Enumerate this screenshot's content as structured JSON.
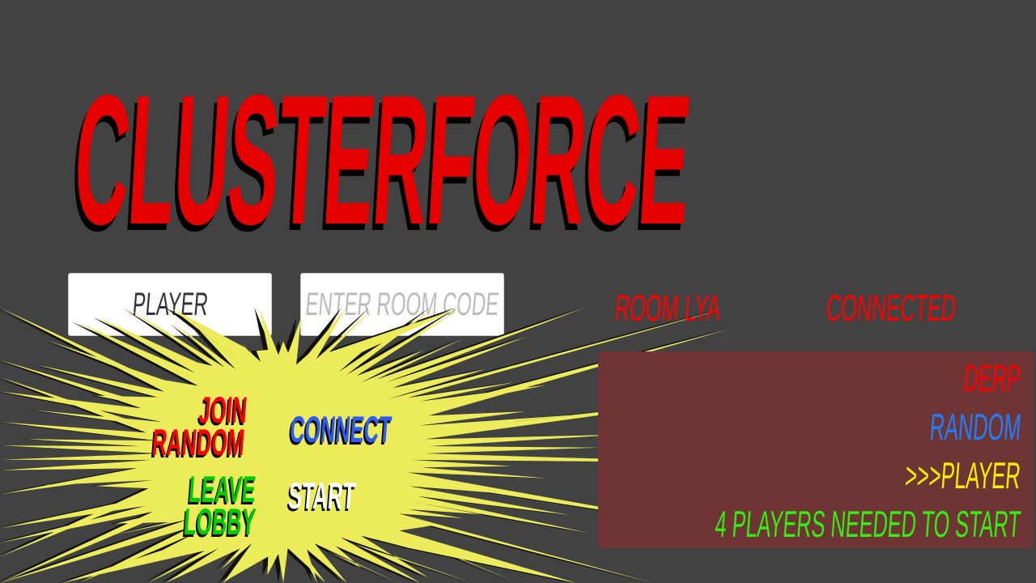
{
  "title": "CLUSTERFORCE",
  "name_field": {
    "value": "PLAYER"
  },
  "room_field": {
    "placeholder": "ENTER ROOM CODE"
  },
  "buttons": {
    "join_random": [
      "JOIN",
      "RANDOM"
    ],
    "connect": "CONNECT",
    "leave_lobby": [
      "LEAVE",
      "LOBBY"
    ],
    "start": "START"
  },
  "room": {
    "label": "ROOM",
    "code": "LYA"
  },
  "status": "CONNECTED",
  "players": [
    {
      "name": "DERP",
      "color": "#ff0000"
    },
    {
      "name": "RANDOM",
      "color": "#1e7fff"
    },
    {
      "name": ">>>PLAYER",
      "color": "#ffee00"
    }
  ],
  "notice": {
    "text": "4 PLAYERS NEEDED TO START",
    "color": "#33ee11"
  },
  "colors": {
    "background": "#424242",
    "title": "#e60000",
    "burst": "#ecec5a",
    "panel": "#6f3535"
  }
}
